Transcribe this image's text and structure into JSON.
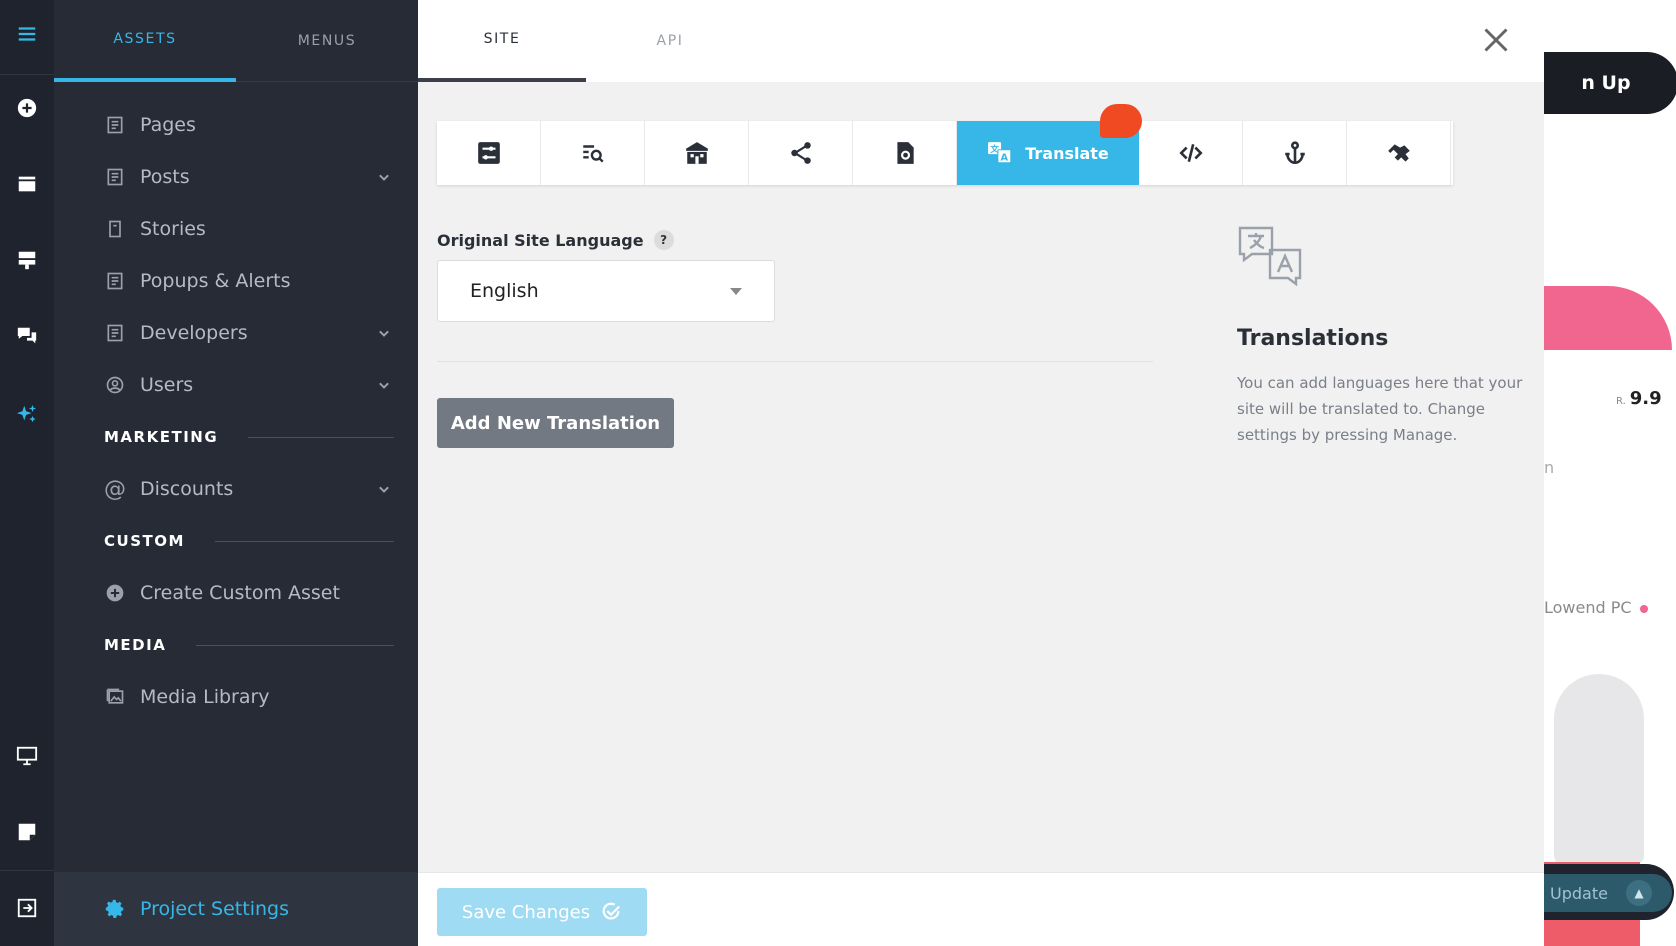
{
  "panel": {
    "tabs": [
      {
        "label": "ASSETS"
      },
      {
        "label": "MENUS"
      }
    ],
    "items": [
      {
        "label": "Pages"
      },
      {
        "label": "Posts"
      },
      {
        "label": "Stories"
      },
      {
        "label": "Popups & Alerts"
      },
      {
        "label": "Developers"
      },
      {
        "label": "Users"
      }
    ],
    "sections": [
      {
        "title": "MARKETING",
        "items": [
          {
            "label": "Discounts"
          }
        ]
      },
      {
        "title": "CUSTOM",
        "items": [
          {
            "label": "Create Custom Asset"
          }
        ]
      },
      {
        "title": "MEDIA",
        "items": [
          {
            "label": "Media Library"
          }
        ]
      }
    ],
    "footer": {
      "label": "Project Settings"
    }
  },
  "main": {
    "tabs": [
      {
        "label": "SITE"
      },
      {
        "label": "API"
      }
    ],
    "toolbar": {
      "active_label": "Translate"
    },
    "language": {
      "label": "Original Site Language",
      "help": "?",
      "value": "English"
    },
    "add_button": "Add New Translation",
    "info": {
      "title": "Translations",
      "text": "You can add languages here that your site will be translated to. Change settings by pressing Manage."
    },
    "save_button": "Save Changes"
  },
  "background": {
    "signup": "n Up",
    "price_prefix": "R.",
    "price": "9.9",
    "stub": "n",
    "lowend": "Lowend PC",
    "update": "Update"
  },
  "colors": {
    "accent": "#36b7e8",
    "badge": "#f04a23",
    "rail": "#1e232d",
    "panel": "#262b35"
  }
}
